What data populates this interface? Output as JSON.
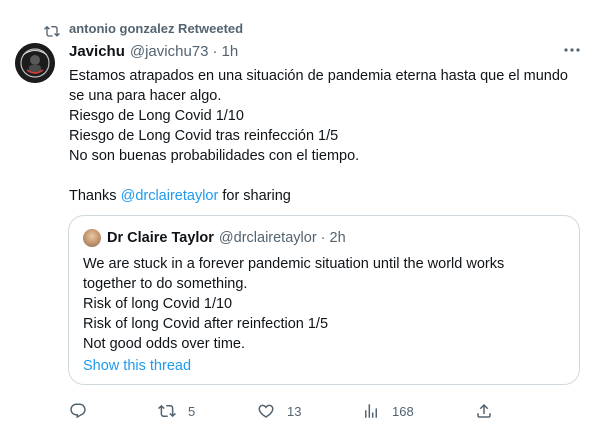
{
  "retweet_header": {
    "icon": "retweet-icon",
    "text": "antonio gonzalez Retweeted"
  },
  "tweet": {
    "author_name": "Javichu",
    "author_handle": "@javichu73",
    "separator": "·",
    "time": "1h",
    "lines": [
      "Estamos atrapados en una situación de pandemia eterna hasta que el mundo",
      "se una para hacer algo.",
      "Riesgo de Long Covid 1/10",
      "Riesgo de Long Covid tras reinfección 1/5",
      "No son buenas probabilidades con el tiempo."
    ],
    "thanks_prefix": "Thanks ",
    "thanks_mention": "@drclairetaylor",
    "thanks_suffix": " for sharing"
  },
  "quote": {
    "author_name": "Dr Claire Taylor",
    "author_handle": "@drclairetaylor",
    "separator": "·",
    "time": "2h",
    "lines": [
      "We are stuck in a forever pandemic situation until the world works",
      "together to do something.",
      "Risk of long Covid 1/10",
      "Risk of long Covid after reinfection 1/5",
      "Not good odds over time."
    ],
    "show_thread": "Show this thread"
  },
  "actions": {
    "reply": {
      "icon": "reply-icon",
      "count": ""
    },
    "retweet": {
      "icon": "retweet-icon",
      "count": "5"
    },
    "like": {
      "icon": "heart-icon",
      "count": "13"
    },
    "views": {
      "icon": "analytics-icon",
      "count": "168"
    },
    "share": {
      "icon": "share-icon",
      "count": ""
    }
  },
  "colors": {
    "text": "#0f1419",
    "secondary": "#536471",
    "link": "#1d9bf0",
    "border": "#cfd9de"
  }
}
